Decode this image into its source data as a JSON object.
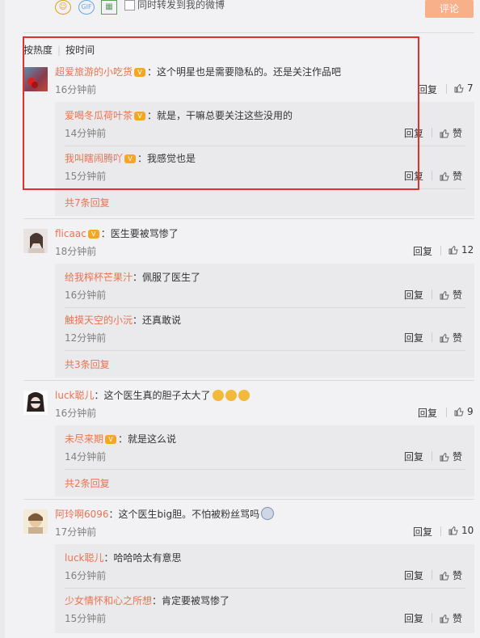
{
  "topbar": {
    "emoji_icon": "☺",
    "gif_icon": "GIF",
    "image_icon": "▦",
    "repost_label": "同时转发到我的微博",
    "submit_label": "评论"
  },
  "sort": {
    "hot": "按热度",
    "time": "按时间"
  },
  "actions": {
    "reply": "回复",
    "like_text": "赞"
  },
  "comments": [
    {
      "user": "超爱旅游的小吃货",
      "text": "：这个明星也是需要隐私的。还是关注作品吧",
      "time": "16分钟前",
      "likes": "7",
      "subs": [
        {
          "user": "爱喝冬瓜荷叶茶",
          "text": "：就是，干嘛总要关注这些没用的",
          "time": "14分钟前"
        },
        {
          "user": "我叫瞎闹腾吖",
          "text": "：我感觉也是",
          "time": "15分钟前"
        }
      ],
      "more": "共7条回复"
    },
    {
      "user": "flicaac",
      "text": "：医生要被骂惨了",
      "time": "18分钟前",
      "likes": "12",
      "subs": [
        {
          "user": "给我榨杯芒果汁",
          "text": "：佩服了医生了",
          "time": "16分钟前"
        },
        {
          "user": "触摸天空的小沅",
          "text": "：还真敢说",
          "time": "12分钟前"
        }
      ],
      "more": "共3条回复"
    },
    {
      "user": "luck聪儿",
      "text": "：这个医生真的胆子太大了",
      "time": "16分钟前",
      "likes": "9",
      "subs": [
        {
          "user": "未尽来期",
          "text": "：就是这么说",
          "time": "14分钟前"
        }
      ],
      "more": "共2条回复"
    },
    {
      "user": "阿玲啊6096",
      "text": "：这个医生big胆。不怕被粉丝骂吗",
      "time": "17分钟前",
      "likes": "10",
      "subs": [
        {
          "user": "luck聪儿",
          "text": "：哈哈哈太有意思",
          "time": "16分钟前"
        },
        {
          "user": "少女情怀和心之所想",
          "text": "：肯定要被骂惨了",
          "time": "15分钟前"
        }
      ]
    }
  ],
  "colors": {
    "username": "#eb7350",
    "highlight": "#e0312c",
    "submit": "#f7b08a"
  }
}
